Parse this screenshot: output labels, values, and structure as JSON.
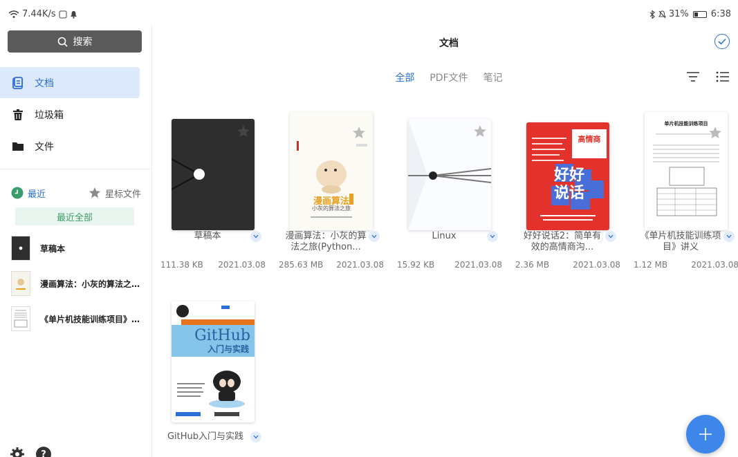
{
  "status_bar": {
    "net_speed": "7.44K/s",
    "battery_percent": "31%",
    "battery_level": 0.31,
    "time": "6:38"
  },
  "sidebar": {
    "search_label": "搜索",
    "nav": [
      {
        "label": "文档",
        "icon": "document-icon",
        "active": true
      },
      {
        "label": "垃圾箱",
        "icon": "trash-icon",
        "active": false
      },
      {
        "label": "文件",
        "icon": "folder-icon",
        "active": false
      }
    ],
    "recent_tab": "最近",
    "starred_tab": "星标文件",
    "recent_all": "最近全部",
    "recent_items": [
      {
        "title": "草稿本"
      },
      {
        "title": "漫画算法：小灰的算法之旅(Python篇)"
      },
      {
        "title": "《单片机技能训练项目》讲义"
      }
    ]
  },
  "main": {
    "title": "文档",
    "tabs": [
      {
        "label": "全部",
        "active": true
      },
      {
        "label": "PDF文件",
        "active": false
      },
      {
        "label": "笔记",
        "active": false
      }
    ],
    "documents": [
      {
        "name": "草稿本",
        "size": "111.38 KB",
        "date": "2021.03.08"
      },
      {
        "name": "漫画算法：小灰的算法之旅(Python...",
        "size": "285.63 MB",
        "date": "2021.03.08"
      },
      {
        "name": "Linux",
        "size": "15.92 KB",
        "date": "2021.03.08"
      },
      {
        "name": "好好说话2：简单有效的高情商沟...",
        "size": "2.36 MB",
        "date": "2021.03.08"
      },
      {
        "name": "《单片机技能训练项目》讲义",
        "size": "1.12 MB",
        "date": "2021.03.08"
      },
      {
        "name": "GitHub入门与实践",
        "size": "",
        "date": ""
      }
    ],
    "covers": {
      "comic_title": "漫画算法",
      "comic_sub": "小灰的算法之旅",
      "eq_top": "高情商",
      "eq_big": "好好说话",
      "mcu_title": "单片机技能训练项目",
      "github_title": "GitHub",
      "github_sub": "入门与实践"
    }
  },
  "colors": {
    "accent": "#2b6fd6",
    "fab": "#3f86ea",
    "active_nav_bg": "#dce9fb",
    "recent_all_bg": "#e9f6ef"
  }
}
